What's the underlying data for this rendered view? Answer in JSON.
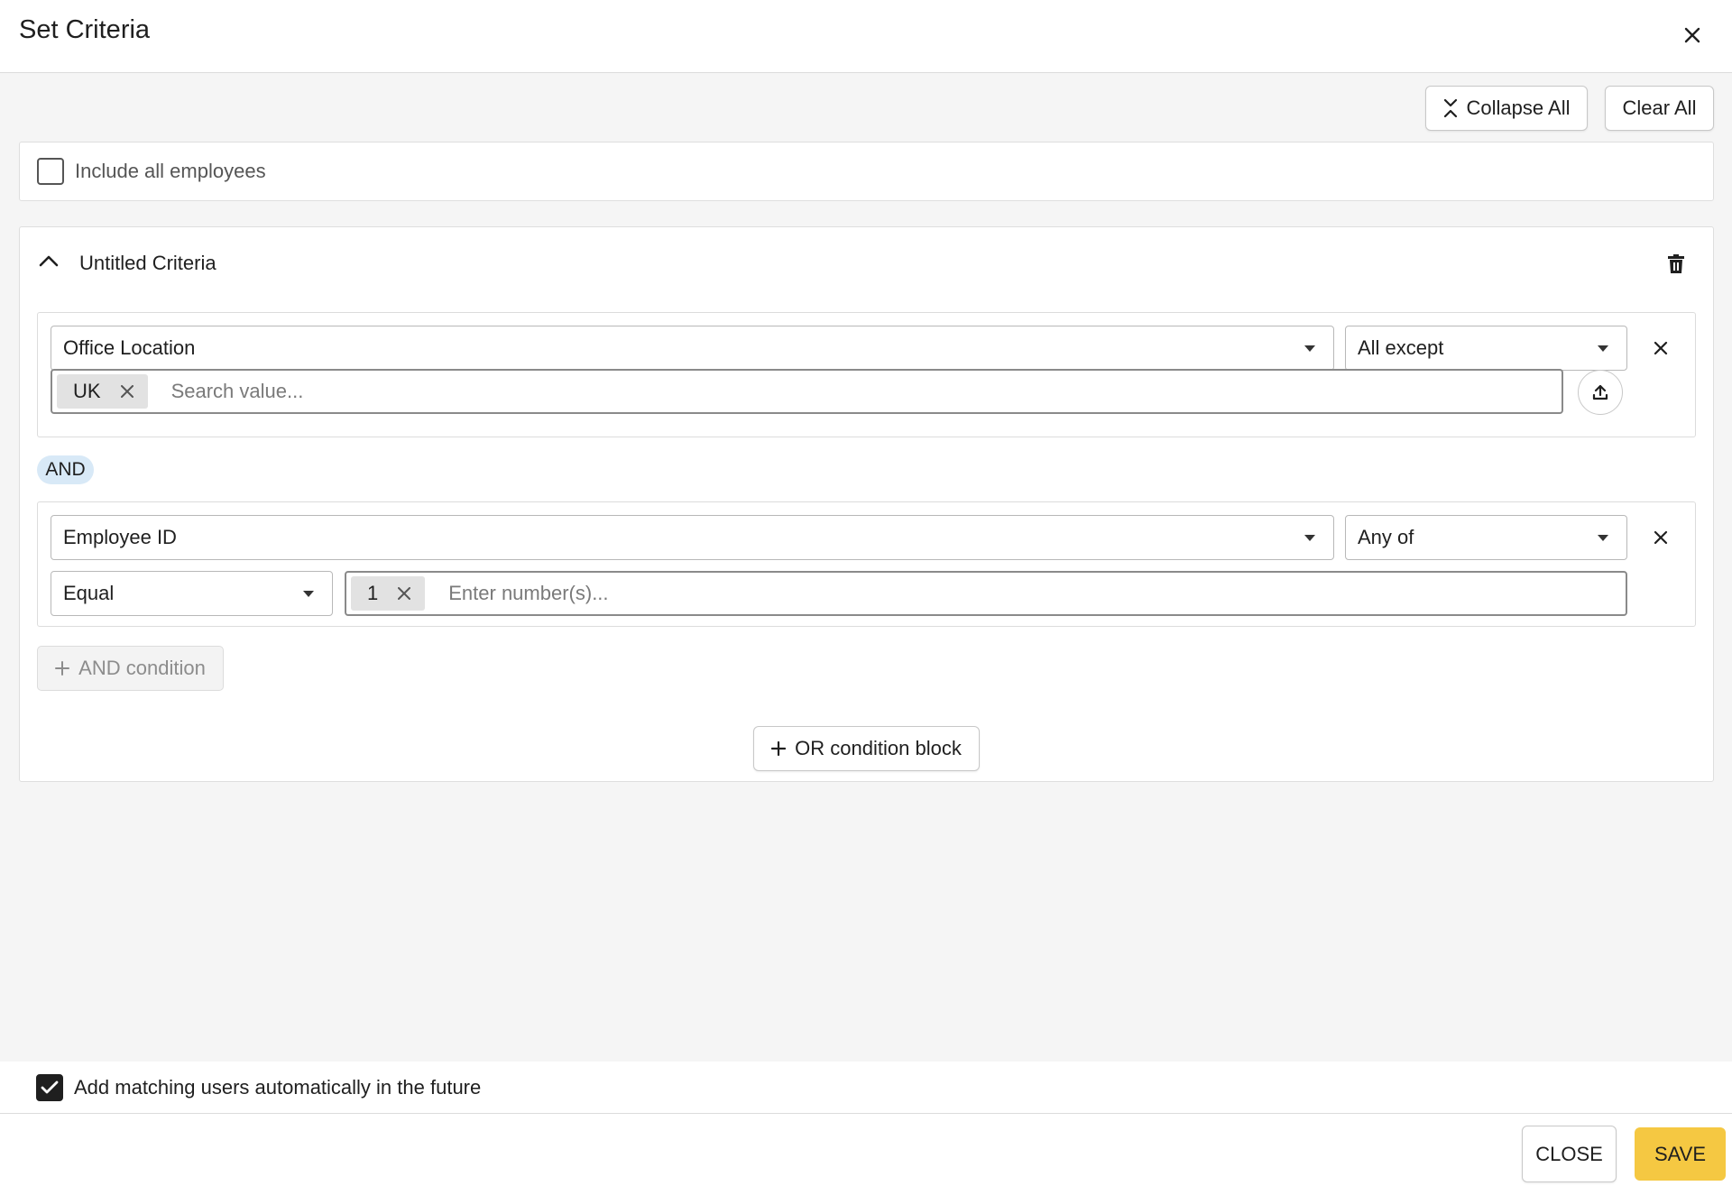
{
  "dialog": {
    "title": "Set Criteria"
  },
  "toolbar": {
    "collapse_all_label": "Collapse All",
    "clear_all_label": "Clear All"
  },
  "include_all": {
    "label": "Include all employees",
    "checked": false
  },
  "criteria_block": {
    "title": "Untitled Criteria",
    "conditions": [
      {
        "field": "Office Location",
        "operator": "All except",
        "chips": [
          "UK"
        ],
        "placeholder": "Search value..."
      },
      {
        "field": "Employee ID",
        "operator": "Any of",
        "comparator": "Equal",
        "chips": [
          "1"
        ],
        "placeholder": "Enter number(s)..."
      }
    ],
    "connector_label": "AND",
    "add_and_label": "AND condition"
  },
  "add_or_label": "OR condition block",
  "auto_add": {
    "label": "Add matching users automatically in the future",
    "checked": true
  },
  "footer": {
    "close_label": "CLOSE",
    "save_label": "SAVE"
  },
  "colors": {
    "save_button": "#f5c842",
    "and_pill": "#d8e9f7",
    "content_background": "#f5f5f5"
  }
}
